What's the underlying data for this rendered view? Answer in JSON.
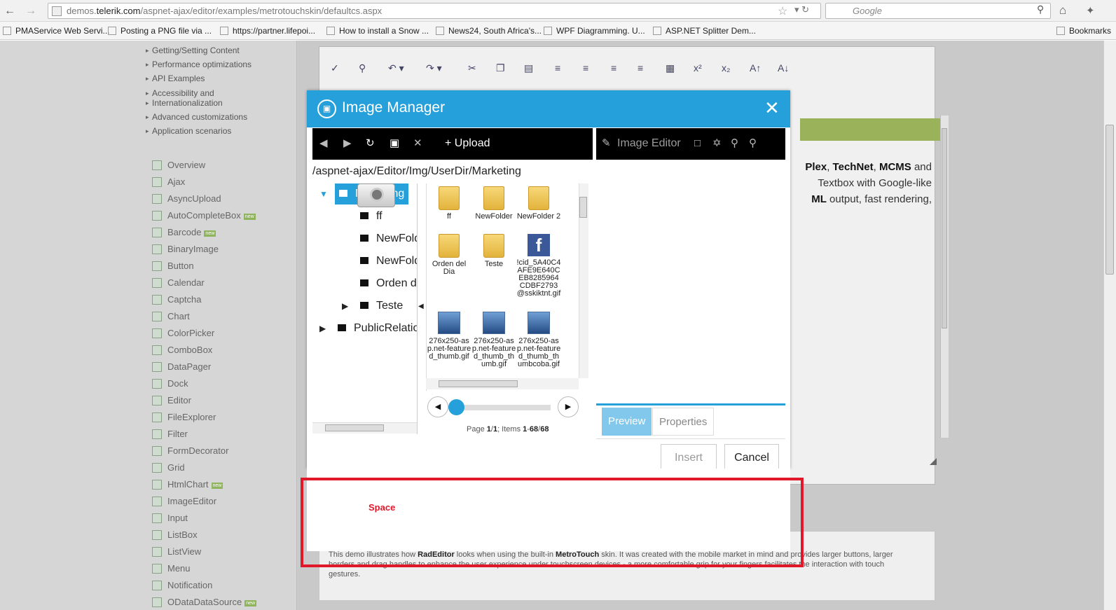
{
  "browser": {
    "url_prefix": "demos.",
    "url_domain": "telerik.com",
    "url_path": "/aspnet-ajax/editor/examples/metrotouchskin/defaultcs.aspx",
    "search_placeholder": "Google",
    "bookmarks": [
      "PMAService Web Servi...",
      "Posting a PNG file via ...",
      "https://partner.lifepoi...",
      "How to install a Snow ...",
      "News24, South Africa's...",
      "WPF Diagramming. U...",
      "ASP.NET Splitter Dem..."
    ],
    "bookmarks_folder": "Bookmarks"
  },
  "sidebar": {
    "sub_items": [
      "Getting/Setting Content",
      "Performance optimizations",
      "API Examples",
      "Accessibility and",
      "Internationalization",
      "Advanced customizations",
      "Application scenarios"
    ],
    "controls": [
      "Overview",
      "Ajax",
      "AsyncUpload",
      "AutoCompleteBox",
      "Barcode",
      "BinaryImage",
      "Button",
      "Calendar",
      "Captcha",
      "Chart",
      "ColorPicker",
      "ComboBox",
      "DataPager",
      "Dock",
      "Editor",
      "FileExplorer",
      "Filter",
      "FormDecorator",
      "Grid",
      "HtmlChart",
      "ImageEditor",
      "Input",
      "ListBox",
      "ListView",
      "Menu",
      "Notification",
      "ODataDataSource"
    ],
    "new_badge": "new"
  },
  "editor": {
    "text_line1_a": "Plex",
    "text_line1_sep": ", ",
    "text_line1_b": "TechNet",
    "text_line1_c": "MCMS",
    "text_line1_end": " and",
    "text_line2": "Textbox with Google-like",
    "text_line3_a": "ML",
    "text_line3_b": " output, fast rendering,",
    "desc_start": "This demo illustrates how ",
    "desc_bold1": "RadEditor",
    "desc_mid": " looks when using the built-in ",
    "desc_bold2": "MetroTouch",
    "desc_end": " skin. It was created with the mobile market in mind and provides larger buttons, larger borders and drag handles to enhance the user experience under touchscreen devices - a more comfortable grip for your fingers facilitates the interaction with touch gestures."
  },
  "dialog": {
    "title": "Image Manager",
    "upload_label": "+ Upload",
    "image_editor_label": "Image Editor",
    "path": "/aspnet-ajax/Editor/Img/UserDir/Marketing",
    "tree": {
      "root": "Marketing",
      "children": [
        "ff",
        "NewFold",
        "NewFold",
        "Orden de",
        "Teste"
      ],
      "sibling": "PublicRelation"
    },
    "files": [
      "ff",
      "NewFolder",
      "NewFolder 2",
      "Orden del Dia",
      "Teste",
      "!cid_5A40C4AFE9E640CEB8285964CDBF2793@sskiktnt.gif",
      "276x250-asp.net-featured_thumb.gif",
      "276x250-asp.net-featured_thumb_thumb.gif",
      "276x250-asp.net-featured_thumb_thumbcoba.gif"
    ],
    "pager": {
      "page_label": "Page ",
      "page_current": "1",
      "page_sep": "/",
      "page_total": "1",
      "items_label": "; Items ",
      "items_from": "1",
      "items_dash": "-",
      "items_to": "68",
      "items_sep": "/",
      "items_total": "68"
    },
    "tab_preview": "Preview",
    "tab_properties": "Properties",
    "insert_label": "Insert",
    "cancel_label": "Cancel",
    "close_glyph": "✕"
  },
  "annotation": {
    "space_label": "Space",
    "color": "#e0182a"
  },
  "colors": {
    "accent": "#25a0da",
    "tab_preview": "#81c8ec"
  }
}
